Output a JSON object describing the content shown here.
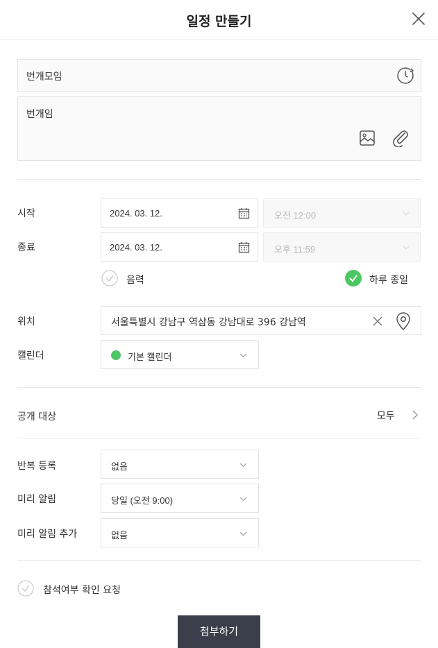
{
  "header": {
    "title": "일정 만들기"
  },
  "event": {
    "title_value": "번개모임",
    "memo_value": "번개임"
  },
  "schedule": {
    "start_label": "시작",
    "end_label": "종료",
    "start_date": "2024. 03. 12.",
    "start_time": "오전 12:00",
    "end_date": "2024. 03. 12.",
    "end_time": "오후 11:59",
    "lunar_label": "음력",
    "lunar_checked": false,
    "allday_label": "하루 종일",
    "allday_checked": true
  },
  "location": {
    "label": "위치",
    "value": "서울특별시 강남구 역삼동 강남대로 396 강남역"
  },
  "calendar": {
    "label": "캘린더",
    "value": "기본 캘린더",
    "color": "#4cc764"
  },
  "visibility": {
    "label": "공개 대상",
    "value": "모두"
  },
  "repeat": {
    "label": "반복 등록",
    "value": "없음"
  },
  "reminder": {
    "label": "미리 알림",
    "value": "당일 (오전 9:00)"
  },
  "reminder_extra": {
    "label": "미리 알림 추가",
    "value": "없음"
  },
  "attendance": {
    "label": "참석여부 확인 요청",
    "checked": false
  },
  "footer": {
    "attach_label": "첨부하기"
  },
  "colors": {
    "accent_green": "#4cc764",
    "button_dark": "#3a3f4b"
  }
}
